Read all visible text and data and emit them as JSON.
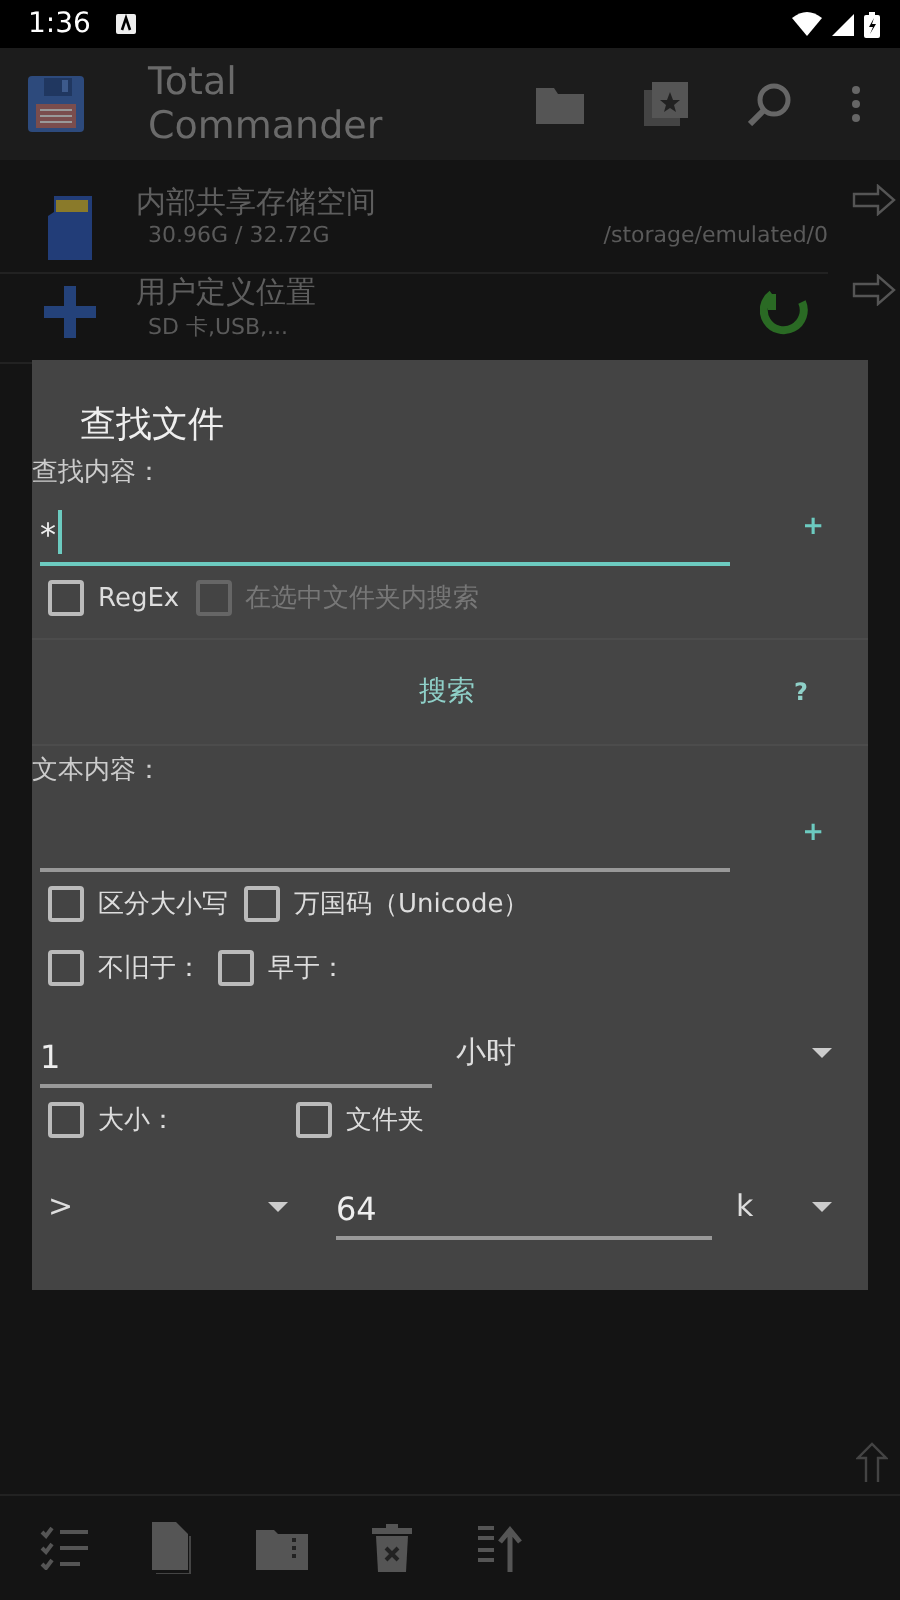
{
  "status_bar": {
    "time": "1:36"
  },
  "app_bar": {
    "title": "Total Commander"
  },
  "locations": [
    {
      "kind": "storage",
      "title": "内部共享存储空间",
      "detail": "30.96G / 32.72G",
      "path": "/storage/emulated/0"
    },
    {
      "kind": "custom",
      "title": "用户定义位置",
      "detail": "SD 卡,USB,..."
    }
  ],
  "dialog": {
    "title": "查找文件",
    "search_label": "查找内容：",
    "search_value": "*",
    "search_add": "+",
    "search_options": [
      {
        "label": "RegEx",
        "checked": false,
        "disabled": false
      },
      {
        "label": "在选中文件夹内搜索",
        "checked": false,
        "disabled": true
      }
    ],
    "search_button": "搜索",
    "help": "?",
    "text_label": "文本内容：",
    "text_add": "+",
    "text_options": [
      {
        "label": "区分大小写",
        "checked": false
      },
      {
        "label": "万国码（Unicode）",
        "checked": false
      }
    ],
    "date_options": [
      {
        "label": "不旧于：",
        "checked": false
      },
      {
        "label": "早于：",
        "checked": false
      }
    ],
    "age_value": "1",
    "age_unit": "小时",
    "size_options": [
      {
        "label": "大小：",
        "checked": false
      },
      {
        "label": "文件夹",
        "checked": false
      }
    ],
    "size_operator": ">",
    "size_value": "64",
    "size_unit": "k"
  }
}
